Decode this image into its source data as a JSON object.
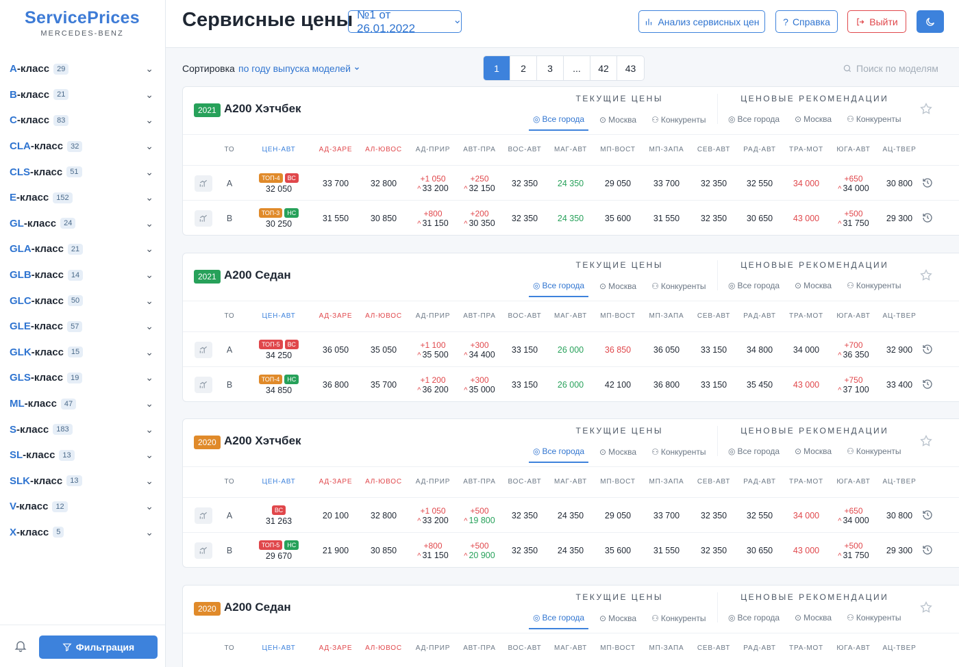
{
  "logo": {
    "main": "ServicePrices",
    "sub": "MERCEDES-BENZ"
  },
  "sidebar": {
    "classes": [
      {
        "letter": "A",
        "suffix": "-класс",
        "count": "29"
      },
      {
        "letter": "B",
        "suffix": "-класс",
        "count": "21"
      },
      {
        "letter": "C",
        "suffix": "-класс",
        "count": "83"
      },
      {
        "letter": "CLA",
        "suffix": "-класс",
        "count": "32"
      },
      {
        "letter": "CLS",
        "suffix": "-класс",
        "count": "51"
      },
      {
        "letter": "E",
        "suffix": "-класс",
        "count": "152"
      },
      {
        "letter": "GL",
        "suffix": "-класс",
        "count": "24"
      },
      {
        "letter": "GLA",
        "suffix": "-класс",
        "count": "21"
      },
      {
        "letter": "GLB",
        "suffix": "-класс",
        "count": "14"
      },
      {
        "letter": "GLC",
        "suffix": "-класс",
        "count": "50"
      },
      {
        "letter": "GLE",
        "suffix": "-класс",
        "count": "57"
      },
      {
        "letter": "GLK",
        "suffix": "-класс",
        "count": "15"
      },
      {
        "letter": "GLS",
        "suffix": "-класс",
        "count": "19"
      },
      {
        "letter": "ML",
        "suffix": "-класс",
        "count": "47"
      },
      {
        "letter": "S",
        "suffix": "-класс",
        "count": "183"
      },
      {
        "letter": "SL",
        "suffix": "-класс",
        "count": "13"
      },
      {
        "letter": "SLK",
        "suffix": "-класс",
        "count": "13"
      },
      {
        "letter": "V",
        "suffix": "-класс",
        "count": "12"
      },
      {
        "letter": "X",
        "suffix": "-класс",
        "count": "5"
      }
    ],
    "filter_label": "Фильтрация"
  },
  "header": {
    "title": "Сервисные цены",
    "doc_select": "№1 от 26.01.2022",
    "analysis_label": "Анализ сервисных цен",
    "help_label": "Справка",
    "logout_label": "Выйти"
  },
  "toolbar": {
    "sort_label": "Сортировка",
    "sort_value": "по году выпуска моделей",
    "pages": [
      "1",
      "2",
      "3",
      "...",
      "42",
      "43"
    ],
    "search_placeholder": "Поиск по моделям"
  },
  "groups": {
    "current": "ТЕКУЩИЕ ЦЕНЫ",
    "recommend": "ЦЕНОВЫЕ РЕКОМЕНДАЦИИ",
    "tabs": [
      "Все города",
      "Москва",
      "Конкуренты"
    ]
  },
  "columns": [
    "ТО",
    "ЦЕН-АВТ",
    "АД-ЗАРЕ",
    "АЛ-ЮВОС",
    "АД-ПРИР",
    "АВТ-ПРА",
    "ВОС-АВТ",
    "МАГ-АВТ",
    "МП-ВОСТ",
    "МП-ЗАПА",
    "СЕВ-АВТ",
    "РАД-АВТ",
    "ТРА-МОТ",
    "ЮГА-АВТ",
    "АЦ-ТВЕР"
  ],
  "colors": {
    "accent": "#3d82dc",
    "red": "#e0474b",
    "green": "#27a15a",
    "orange": "#e08a2a"
  },
  "cards": [
    {
      "year": "2021",
      "year_color": "green",
      "model": "A200 Хэтчбек",
      "rows": [
        {
          "to": "A",
          "badges": [
            {
              "t": "ТОП-4",
              "k": "top"
            },
            {
              "t": "ВС",
              "k": "vs"
            }
          ],
          "cen": "32 050",
          "ad_zare": "33 700",
          "al_yuvos": "32 800",
          "ad_prir_delta": "+1 050",
          "ad_prir": "33 200",
          "avt_pra_delta": "+250",
          "avt_pra": "32 150",
          "vos_avt": "32 350",
          "mag_avt": "24 350",
          "mp_vost": "29 050",
          "mp_zapa": "33 700",
          "sev_avt": "32 350",
          "rad_avt": "32 550",
          "tra_mot": "34 000",
          "yuga_delta": "+650",
          "yuga": "34 000",
          "ac_tver": "30 800"
        },
        {
          "to": "B",
          "badges": [
            {
              "t": "ТОП-3",
              "k": "top"
            },
            {
              "t": "НС",
              "k": "ns"
            }
          ],
          "cen": "30 250",
          "ad_zare": "31 550",
          "al_yuvos": "30 850",
          "ad_prir_delta": "+800",
          "ad_prir": "31 150",
          "avt_pra_delta": "+200",
          "avt_pra": "30 350",
          "vos_avt": "32 350",
          "mag_avt": "24 350",
          "mp_vost": "35 600",
          "mp_zapa": "31 550",
          "sev_avt": "32 350",
          "rad_avt": "30 650",
          "tra_mot": "43 000",
          "yuga_delta": "+500",
          "yuga": "31 750",
          "ac_tver": "29 300"
        }
      ]
    },
    {
      "year": "2021",
      "year_color": "green",
      "model": "A200 Седан",
      "rows": [
        {
          "to": "A",
          "badges": [
            {
              "t": "ТОП-5",
              "k": "vs"
            },
            {
              "t": "ВС",
              "k": "vs"
            }
          ],
          "cen": "34 250",
          "ad_zare": "36 050",
          "al_yuvos": "35 050",
          "ad_prir_delta": "+1 100",
          "ad_prir": "35 500",
          "avt_pra_delta": "+300",
          "avt_pra": "34 400",
          "vos_avt": "33 150",
          "mag_avt": "26 000",
          "mp_vost": "36 850",
          "mp_zapa": "36 050",
          "sev_avt": "33 150",
          "rad_avt": "34 800",
          "tra_mot": "34 000",
          "yuga_delta": "+700",
          "yuga": "36 350",
          "ac_tver": "32 900"
        },
        {
          "to": "B",
          "badges": [
            {
              "t": "ТОП-4",
              "k": "top"
            },
            {
              "t": "НС",
              "k": "ns"
            }
          ],
          "cen": "34 850",
          "ad_zare": "36 800",
          "al_yuvos": "35 700",
          "ad_prir_delta": "+1 200",
          "ad_prir": "36 200",
          "avt_pra_delta": "+300",
          "avt_pra": "35 000",
          "vos_avt": "33 150",
          "mag_avt": "26 000",
          "mp_vost": "42 100",
          "mp_zapa": "36 800",
          "sev_avt": "33 150",
          "rad_avt": "35 450",
          "tra_mot": "43 000",
          "yuga_delta": "+750",
          "yuga": "37 100",
          "ac_tver": "33 400"
        }
      ]
    },
    {
      "year": "2020",
      "year_color": "orange",
      "model": "A200 Хэтчбек",
      "rows": [
        {
          "to": "A",
          "badges": [
            {
              "t": "ВС",
              "k": "vs"
            }
          ],
          "cen": "31 263",
          "ad_zare": "20 100",
          "al_yuvos": "32 800",
          "ad_prir_delta": "+1 050",
          "ad_prir": "33 200",
          "avt_pra_delta": "+500",
          "avt_pra": "19 800",
          "vos_avt": "32 350",
          "mag_avt": "24 350",
          "mp_vost": "29 050",
          "mp_zapa": "33 700",
          "sev_avt": "32 350",
          "rad_avt": "32 550",
          "tra_mot": "34 000",
          "yuga_delta": "+650",
          "yuga": "34 000",
          "ac_tver": "30 800"
        },
        {
          "to": "B",
          "badges": [
            {
              "t": "ТОП-5",
              "k": "vs"
            },
            {
              "t": "НС",
              "k": "ns"
            }
          ],
          "cen": "29 670",
          "ad_zare": "21 900",
          "al_yuvos": "30 850",
          "ad_prir_delta": "+800",
          "ad_prir": "31 150",
          "avt_pra_delta": "+500",
          "avt_pra": "20 900",
          "vos_avt": "32 350",
          "mag_avt": "24 350",
          "mp_vost": "35 600",
          "mp_zapa": "31 550",
          "sev_avt": "32 350",
          "rad_avt": "30 650",
          "tra_mot": "43 000",
          "yuga_delta": "+500",
          "yuga": "31 750",
          "ac_tver": "29 300"
        }
      ]
    },
    {
      "year": "2020",
      "year_color": "orange",
      "model": "A200 Седан",
      "rows": []
    }
  ]
}
